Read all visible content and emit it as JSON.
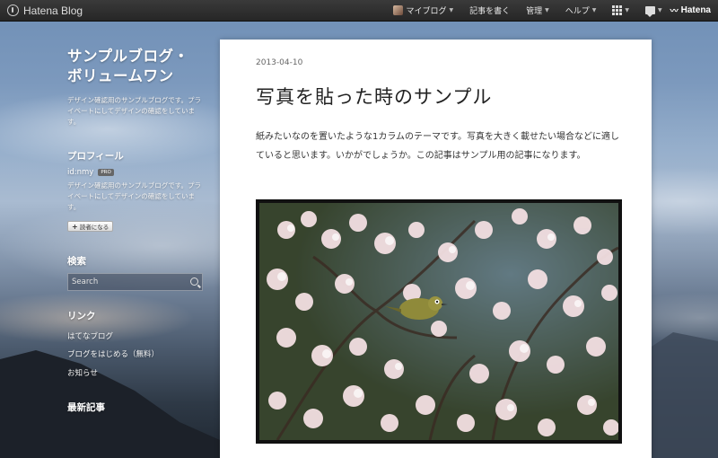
{
  "topbar": {
    "brand": "Hatena Blog",
    "nav": {
      "my_blog": "マイブログ",
      "write": "記事を書く",
      "manage": "管理",
      "help": "ヘルプ",
      "hatena": "Hatena"
    }
  },
  "sidebar": {
    "blog_title_line1": "サンプルブログ・",
    "blog_title_line2": "ボリュームワン",
    "blog_description": "デザイン確認用のサンプルブログです。プライベートにしてデザインの確認をしています。",
    "profile": {
      "heading": "プロフィール",
      "id": "id:nmy",
      "badge": "PRO",
      "description": "デザイン確認用のサンプルブログです。プライベートにしてデザインの確認をしています。",
      "subscribe_label": "読者になる"
    },
    "search": {
      "heading": "検索",
      "placeholder": "Search"
    },
    "links": {
      "heading": "リンク",
      "items": [
        "はてなブログ",
        "ブログをはじめる（無料）",
        "お知らせ"
      ]
    },
    "recent": {
      "heading": "最新記事"
    }
  },
  "article": {
    "date": "2013-04-10",
    "title": "写真を貼った時のサンプル",
    "body": "紙みたいなのを置いたような1カラムのテーマです。写真を大きく載せたい場合などに適していると思います。いかがでしょうか。この記事はサンプル用の記事になります。"
  }
}
